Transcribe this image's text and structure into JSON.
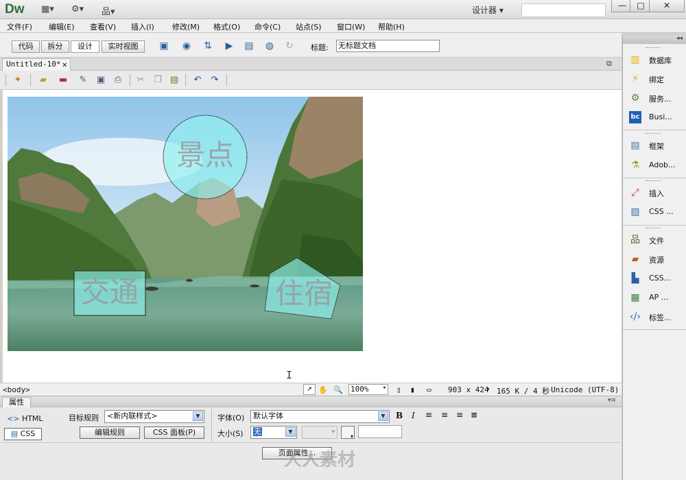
{
  "app": {
    "logo": "Dw",
    "workspace": "设计器 ▾"
  },
  "titlebar": {
    "btn_min": "—",
    "btn_max": "□",
    "btn_close": "✕"
  },
  "menu": [
    "文件(F)",
    "编辑(E)",
    "查看(V)",
    "插入(I)",
    "修改(M)",
    "格式(O)",
    "命令(C)",
    "站点(S)",
    "窗口(W)",
    "帮助(H)"
  ],
  "doc_toolbar": {
    "views": [
      "代码",
      "拆分",
      "设计",
      "实时视图"
    ],
    "active_view": "设计",
    "title_label": "标题:",
    "title_value": "无标题文档"
  },
  "tab": {
    "name": "Untitled-10*",
    "close": "✕"
  },
  "design": {
    "hotspots": [
      "景点",
      "交通",
      "住宿"
    ]
  },
  "status": {
    "tag": "<body>",
    "zoom": "100%",
    "size": "903 x 424",
    "download": "165 K / 4 秒",
    "encoding": "Unicode (UTF-8)"
  },
  "properties": {
    "header": "属性",
    "html_btn": "HTML",
    "css_btn": "CSS",
    "target_rule_label": "目标规则",
    "target_rule_value": "<新内联样式>",
    "edit_rule_btn": "编辑规则",
    "css_panel_btn": "CSS 面板(P)",
    "font_label": "字体(O)",
    "font_value": "默认字体",
    "size_label": "大小(S)",
    "size_value": "无",
    "page_props_btn": "页面属性..."
  },
  "right_panel": {
    "group1": [
      {
        "icon": "database-icon",
        "label": "数据库"
      },
      {
        "icon": "bindings-icon",
        "label": "绑定"
      },
      {
        "icon": "server-behaviors-icon",
        "label": "服务..."
      },
      {
        "icon": "business-catalyst-icon",
        "label": "Busi..."
      }
    ],
    "group2": [
      {
        "icon": "frames-icon",
        "label": "框架"
      },
      {
        "icon": "adobe-browserlab-icon",
        "label": "Adob..."
      }
    ],
    "group3": [
      {
        "icon": "insert-icon",
        "label": "插入"
      },
      {
        "icon": "css-transitions-icon",
        "label": "CSS ..."
      }
    ],
    "group4": [
      {
        "icon": "files-icon",
        "label": "文件"
      },
      {
        "icon": "assets-icon",
        "label": "资源"
      },
      {
        "icon": "css-styles-icon",
        "label": "CSS..."
      },
      {
        "icon": "ap-elements-icon",
        "label": "AP ..."
      },
      {
        "icon": "tag-inspector-icon",
        "label": "标签..."
      }
    ]
  },
  "watermark": "人人素材"
}
